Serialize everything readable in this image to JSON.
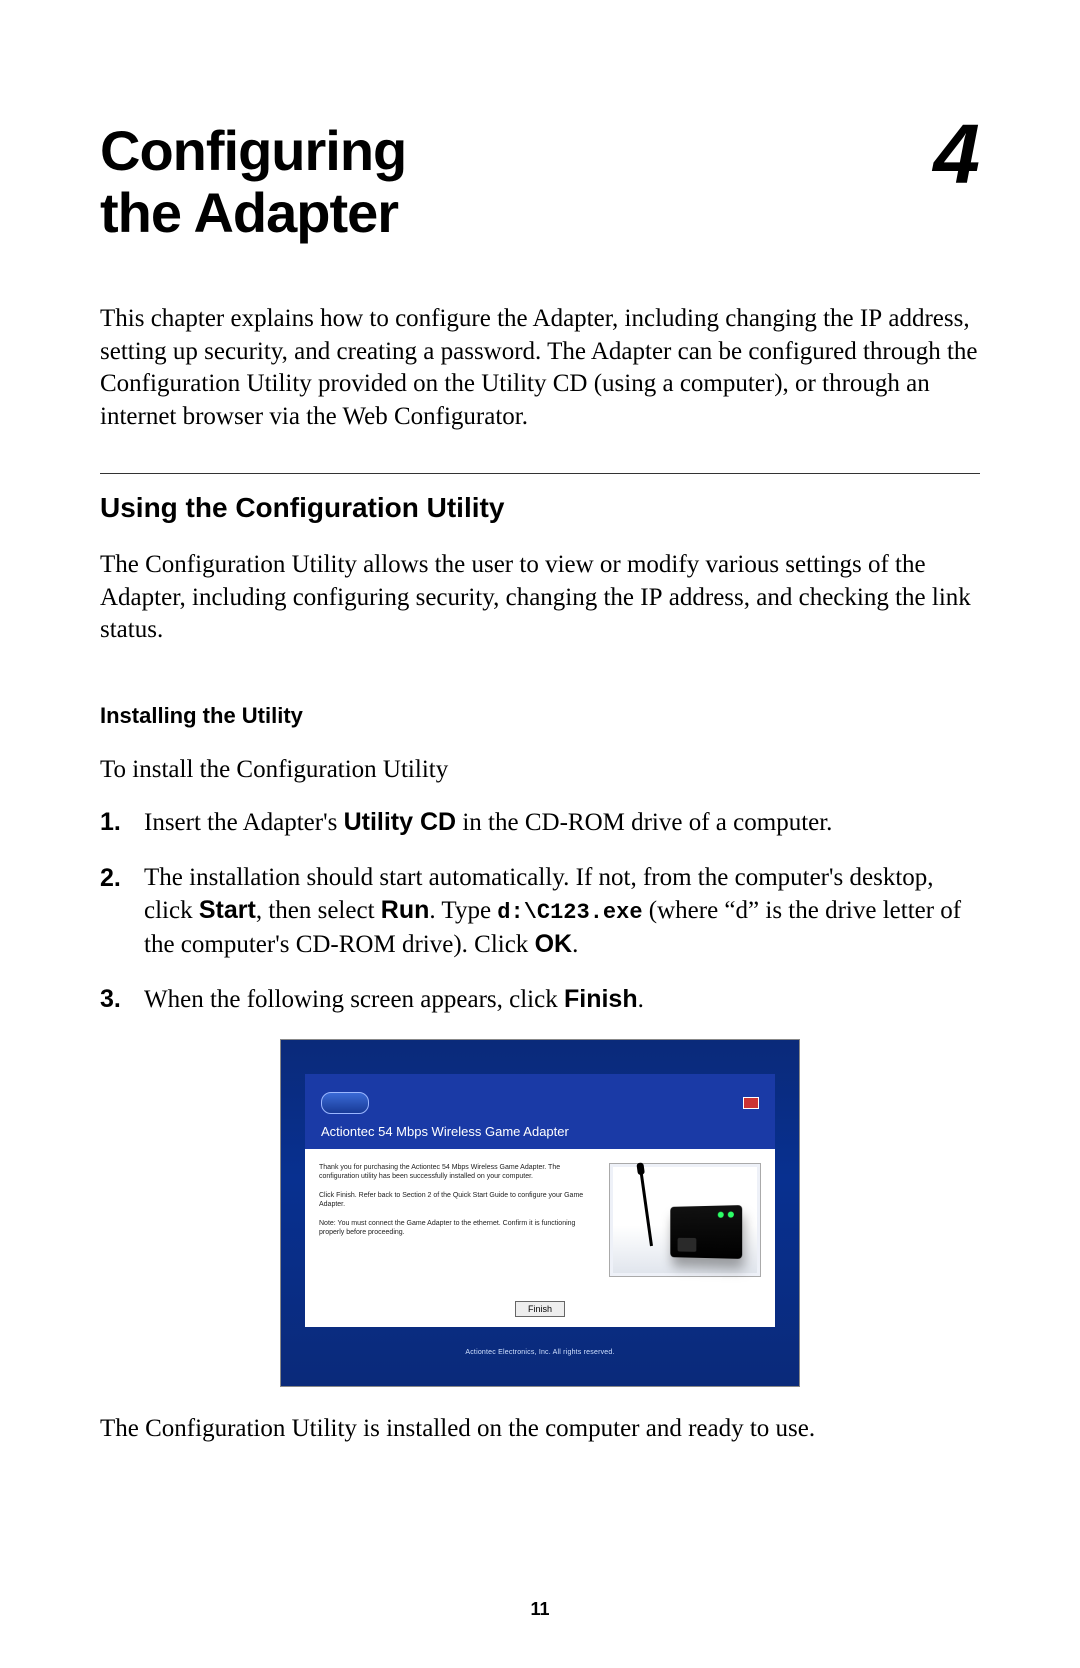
{
  "chapter": {
    "title_line1": "Configuring",
    "title_line2": "the Adapter",
    "number": "4"
  },
  "intro": {
    "pre": "This chapter explains how to configure the Adapter, including changing the ",
    "sc1": "IP",
    "mid1": " address, setting up security, and creating a password. The Adapter can be configured through the Configuration Utility provided on the Utility ",
    "sc2": "CD",
    "mid2": " (using a computer), or through an internet browser via the Web Configurator."
  },
  "section": {
    "heading": "Using the Configuration Utility",
    "body_pre": "The Configuration Utility allows the user to view or modify various settings of the Adapter, including configuring security, changing the ",
    "body_sc": "IP",
    "body_post": " address, and checking the link status."
  },
  "subsection": {
    "heading": "Installing the Utility",
    "lead": "To install the Configuration Utility"
  },
  "steps": {
    "s1": {
      "num": "1.",
      "a": "Insert the Adapter's ",
      "b1": "Utility CD",
      "c": " in the ",
      "sc": "CD-ROM",
      "d": " drive of a computer."
    },
    "s2": {
      "num": "2.",
      "a": "The installation should start automatically. If not, from the computer's desktop, click ",
      "b1": "Start",
      "b2": ", then select ",
      "b3": "Run",
      "b4": ". Type ",
      "code": "d:\\C123.exe",
      "c": "  (where “d” is the drive letter of the computer's ",
      "sc": "CD-ROM",
      "d": " drive). Click ",
      "b5": "OK",
      "e": "."
    },
    "s3": {
      "num": "3.",
      "a": "When the following screen appears, click ",
      "b1": "Finish",
      "c": "."
    }
  },
  "installer": {
    "title": "Actiontec 54 Mbps Wireless Game Adapter",
    "p1": "Thank you for purchasing the Actiontec 54 Mbps Wireless Game Adapter. The configuration utility has been successfully installed on your computer.",
    "p2": "Click Finish. Refer back to Section 2 of the Quick Start Guide to configure your Game Adapter.",
    "p3": "Note: You must connect the Game Adapter to the ethernet. Confirm it is functioning properly before proceeding.",
    "finish": "Finish",
    "footer": "Actiontec Electronics, Inc. All rights reserved."
  },
  "closing": "The Configuration Utility is installed on the computer and ready to use.",
  "page_number": "11"
}
